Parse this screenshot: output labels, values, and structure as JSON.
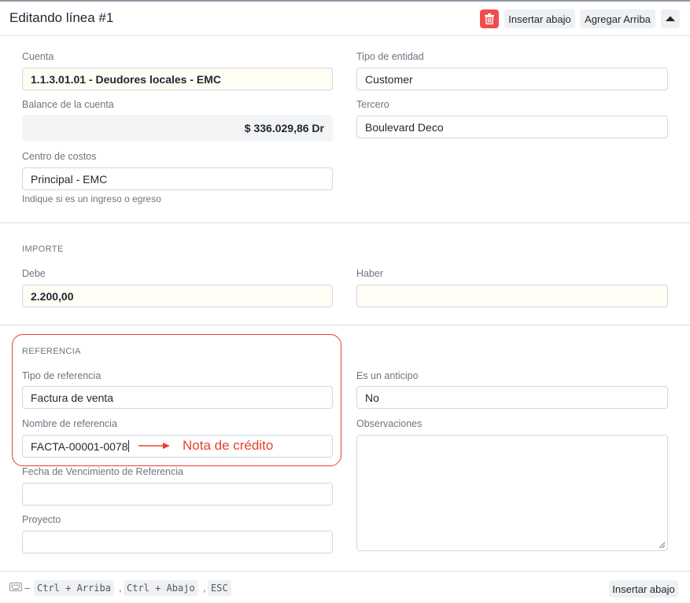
{
  "header": {
    "title": "Editando línea #1",
    "insert_below_label": "Insertar abajo",
    "add_above_label": "Agregar Arriba"
  },
  "cuenta": {
    "label": "Cuenta",
    "value": "1.1.3.01.01 - Deudores locales - EMC"
  },
  "tipo_entidad": {
    "label": "Tipo de entidad",
    "value": "Customer"
  },
  "balance": {
    "label": "Balance de la cuenta",
    "value": "$ 336.029,86 Dr"
  },
  "tercero": {
    "label": "Tercero",
    "value": "Boulevard Deco"
  },
  "centro_costos": {
    "label": "Centro de costos",
    "value": "Principal - EMC",
    "help": "Indique si es un ingreso o egreso"
  },
  "importe": {
    "heading": "IMPORTE",
    "debe_label": "Debe",
    "debe_value": "2.200,00",
    "haber_label": "Haber",
    "haber_value": ""
  },
  "referencia": {
    "heading": "REFERENCIA",
    "tipo_label": "Tipo de referencia",
    "tipo_value": "Factura de venta",
    "anticipo_label": "Es un anticipo",
    "anticipo_value": "No",
    "nombre_label": "Nombre de referencia",
    "nombre_value": "FACTA-00001-0078",
    "observaciones_label": "Observaciones",
    "fecha_label": "Fecha de Vencimiento de Referencia",
    "fecha_value": "",
    "proyecto_label": "Proyecto",
    "proyecto_value": ""
  },
  "annotation": {
    "text": "Nota de crédito",
    "color": "#e8402c"
  },
  "footer": {
    "shortcut_up": "Ctrl + Arriba",
    "shortcut_down": "Ctrl + Abajo",
    "shortcut_esc": "ESC",
    "insert_below_label": "Insertar abajo"
  },
  "colors": {
    "danger": "#f04e4e",
    "highlight_field": "#fffdf4",
    "annotation": "#e8402c"
  }
}
